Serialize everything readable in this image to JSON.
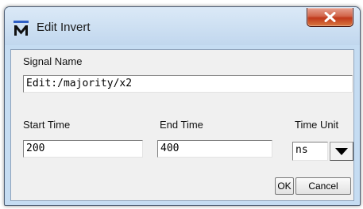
{
  "window": {
    "title": "Edit Invert",
    "app_icon": "m-logo-icon",
    "close_icon": "close-icon"
  },
  "signal": {
    "label": "Signal Name",
    "value": "Edit:/majority/x2"
  },
  "start": {
    "label": "Start Time",
    "value": "200"
  },
  "end": {
    "label": "End Time",
    "value": "400"
  },
  "unit": {
    "label": "Time Unit",
    "value": "ns",
    "dropdown_icon": "triangle-down-icon"
  },
  "buttons": {
    "ok": "OK",
    "cancel": "Cancel"
  },
  "colors": {
    "title_bar": "#c5dcf2",
    "close_button": "#c7472a",
    "client_bg": "#f0f0f0"
  }
}
